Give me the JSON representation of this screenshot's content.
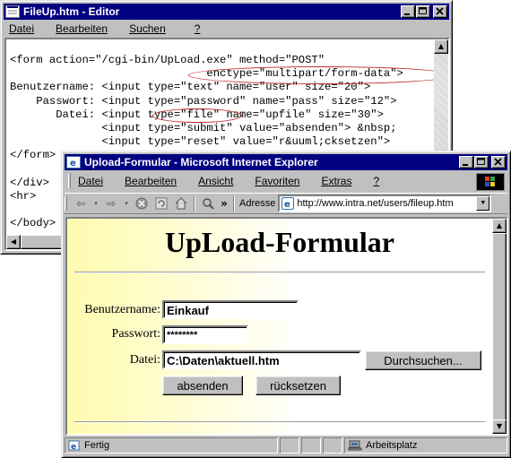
{
  "editor": {
    "title": "FileUp.htm - Editor",
    "menu": [
      "Datei",
      "Bearbeiten",
      "Suchen",
      "?"
    ],
    "code_lines": [
      "<form action=\"/cgi-bin/UpLoad.exe\" method=\"POST\"",
      "                              enctype=\"multipart/form-data\">",
      "Benutzername: <input type=\"text\" name=\"user\" size=\"20\">",
      "    Passwort: <input type=\"password\" name=\"pass\" size=\"12\">",
      "       Datei: <input type=\"file\" name=\"upfile\" size=\"30\">",
      "              <input type=\"submit\" value=\"absenden\"> &nbsp;",
      "              <input type=\"reset\" value=\"r&uuml;cksetzen\">",
      "</form>",
      "",
      "</div>",
      "<hr>",
      "",
      "</body>"
    ]
  },
  "ie": {
    "title": "Upload-Formular - Microsoft Internet Explorer",
    "menu": [
      "Datei",
      "Bearbeiten",
      "Ansicht",
      "Favoriten",
      "Extras",
      "?"
    ],
    "address_label": "Adresse",
    "address_url": "http://www.intra.net/users/fileup.htm",
    "status_text": "Fertig",
    "zone_text": "Arbeitsplatz"
  },
  "page": {
    "heading": "UpLoad-Formular",
    "user_label": "Benutzername:",
    "user_value": "Einkauf",
    "pass_label": "Passwort:",
    "pass_value": "********",
    "file_label": "Datei:",
    "file_value": "C:\\Daten\\aktuell.htm",
    "browse_label": "Durchsuchen...",
    "submit_label": "absenden",
    "reset_label": "rücksetzen"
  },
  "colors": {
    "titlebar": "#000080",
    "window": "#c0c0c0",
    "highlight_ellipse": "#c0282c",
    "page_gradient_start": "#fffbb0"
  }
}
